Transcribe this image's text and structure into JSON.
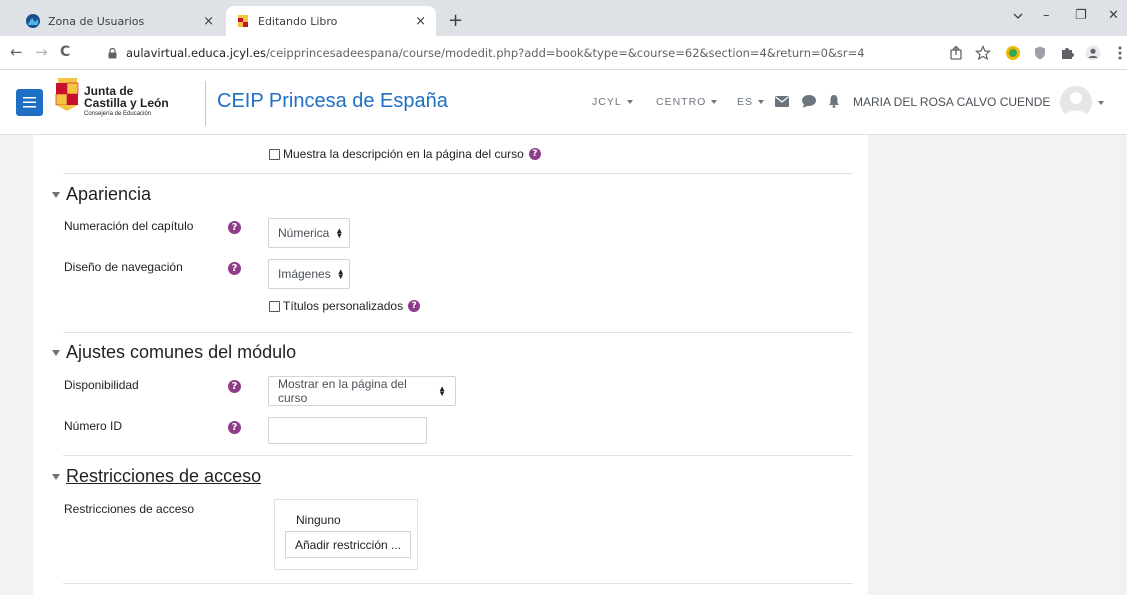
{
  "browser": {
    "tabs": [
      {
        "title": "Zona de Usuarios",
        "active": false
      },
      {
        "title": "Editando Libro",
        "active": true
      }
    ],
    "new_tab": "+",
    "close": "×",
    "window_controls": {
      "minimize": "–",
      "restore": "❐",
      "close": "✕"
    },
    "nav": {
      "back": "←",
      "forward": "→",
      "reload": "C"
    },
    "url_host": "aulavirtual.educa.jcyl.es",
    "url_path": "/ceipprincesadeespana/course/modedit.php?add=book&type=&course=62&section=4&return=0&sr=4"
  },
  "header": {
    "logo": {
      "line1": "Junta de",
      "line2": "Castilla y León",
      "line3": "Consejería de Educación"
    },
    "site_name": "CEIP Princesa de España",
    "menus": [
      {
        "label": "JCYL"
      },
      {
        "label": "CENTRO"
      },
      {
        "label": "ES"
      }
    ],
    "user_name": "MARIA DEL ROSA CALVO CUENDE"
  },
  "form": {
    "show_description_label": "Muestra la descripción en la página del curso",
    "section_appearance": "Apariencia",
    "chapter_numbering_label": "Numeración del capítulo",
    "chapter_numbering_value": "Númerica",
    "navigation_design_label": "Diseño de navegación",
    "navigation_design_value": "Imágenes",
    "custom_titles_label": "Títulos personalizados",
    "section_common": "Ajustes comunes del módulo",
    "availability_label": "Disponibilidad",
    "availability_value": "Mostrar en la página del curso",
    "id_number_label": "Número ID",
    "id_number_value": "",
    "section_restrictions": "Restricciones de acceso",
    "restrictions_label": "Restricciones de acceso",
    "restrictions_none": "Ninguno",
    "add_restriction_button": "Añadir restricción ..."
  },
  "colors": {
    "brand_blue": "#1f6fc5",
    "help_purple": "#8f3c8a"
  }
}
